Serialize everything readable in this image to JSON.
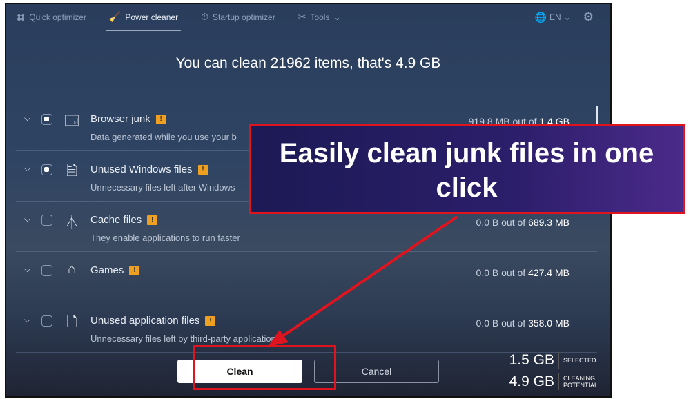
{
  "nav": {
    "items": [
      {
        "label": "Quick optimizer",
        "icon": "grid-icon"
      },
      {
        "label": "Power cleaner",
        "icon": "broom-icon",
        "active": true
      },
      {
        "label": "Startup optimizer",
        "icon": "stopwatch-icon"
      },
      {
        "label": "Tools",
        "icon": "wrench-icon"
      }
    ],
    "language": "EN"
  },
  "headline": "You can clean 21962 items, that's 4.9 GB",
  "items": [
    {
      "title": "Browser junk",
      "desc": "Data generated while you use your b",
      "cleaned": "919.8 MB",
      "total": "1.4 GB",
      "checked": true,
      "icon": "browser-icon"
    },
    {
      "title": "Unused Windows files",
      "desc": "Unnecessary files left after Windows",
      "cleaned": "",
      "total": "",
      "checked": true,
      "icon": "document-icon"
    },
    {
      "title": "Cache files",
      "desc": "They enable applications to run faster",
      "cleaned": "0.0 B",
      "total": "689.3 MB",
      "checked": false,
      "icon": "broom-icon"
    },
    {
      "title": "Games",
      "desc": "",
      "cleaned": "0.0 B",
      "total": "427.4 MB",
      "checked": false,
      "icon": "brush-icon"
    },
    {
      "title": "Unused application files",
      "desc": "Unnecessary files left by third-party applications",
      "cleaned": "0.0 B",
      "total": "358.0 MB",
      "checked": false,
      "icon": "file-icon"
    }
  ],
  "out_of": "out of",
  "buttons": {
    "clean": "Clean",
    "cancel": "Cancel"
  },
  "stats": {
    "selected_value": "1.5 GB",
    "selected_label": "SELECTED",
    "potential_value": "4.9 GB",
    "potential_label": "CLEANING POTENTIAL"
  },
  "callout": "Easily clean junk files in one click",
  "colors": {
    "annotation": "#e0141e",
    "warning": "#f0a020"
  }
}
